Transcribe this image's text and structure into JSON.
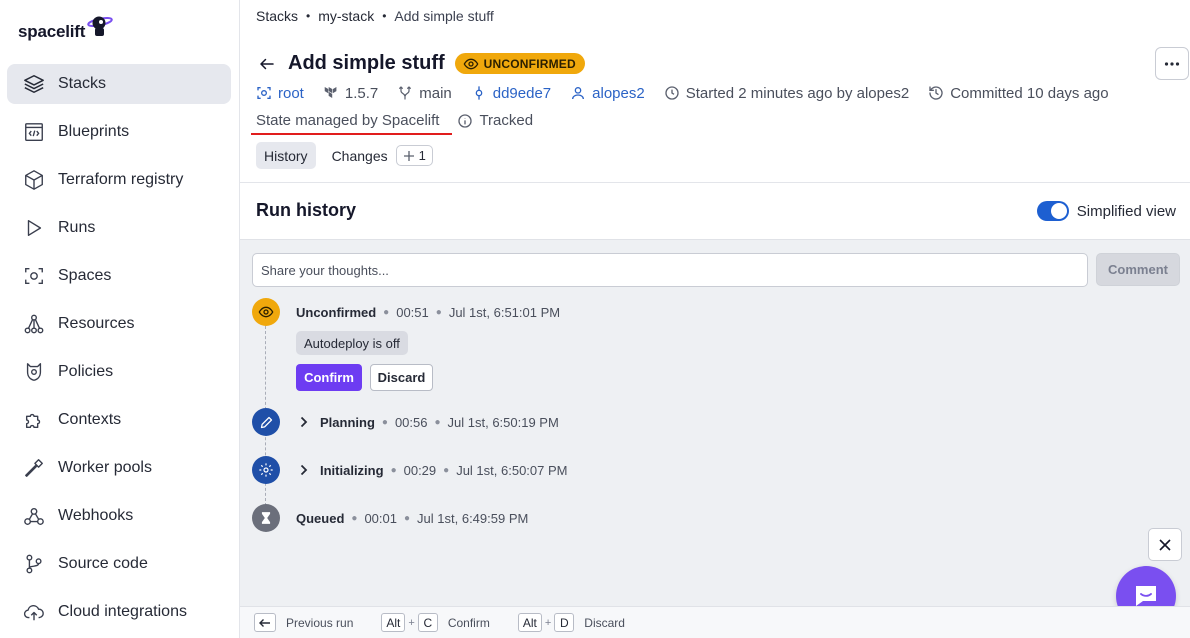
{
  "app": {
    "logo_text": "spacelift"
  },
  "sidebar": {
    "items": [
      {
        "label": "Stacks",
        "icon": "layers-icon",
        "active": true
      },
      {
        "label": "Blueprints",
        "icon": "blueprint-icon"
      },
      {
        "label": "Terraform registry",
        "icon": "cube-icon"
      },
      {
        "label": "Runs",
        "icon": "play-icon"
      },
      {
        "label": "Spaces",
        "icon": "spaces-icon"
      },
      {
        "label": "Resources",
        "icon": "resources-icon"
      },
      {
        "label": "Policies",
        "icon": "policy-icon"
      },
      {
        "label": "Contexts",
        "icon": "puzzle-icon"
      },
      {
        "label": "Worker pools",
        "icon": "hammer-icon"
      },
      {
        "label": "Webhooks",
        "icon": "webhook-icon"
      },
      {
        "label": "Source code",
        "icon": "git-icon"
      },
      {
        "label": "Cloud integrations",
        "icon": "cloud-icon"
      }
    ]
  },
  "breadcrumb": {
    "items": [
      "Stacks",
      "my-stack",
      "Add simple stuff"
    ],
    "separator": "•"
  },
  "header": {
    "title": "Add simple stuff",
    "badge": "UNCONFIRMED",
    "badge_color": "#f0a80c",
    "meta": {
      "space": "root",
      "version": "1.5.7",
      "branch": "main",
      "commit": "dd9ede7",
      "user": "alopes2",
      "started": "Started 2 minutes ago by alopes2",
      "committed": "Committed 10 days ago"
    },
    "state": "State managed by Spacelift",
    "tracked": "Tracked"
  },
  "tabs": {
    "history": "History",
    "changes": "Changes",
    "changes_count": "1"
  },
  "run_history": {
    "title": "Run history",
    "toggle_label": "Simplified view",
    "toggle_on": true,
    "comment_placeholder": "Share your thoughts...",
    "comment_button": "Comment",
    "timeline": [
      {
        "name": "Unconfirmed",
        "duration": "00:51",
        "time": "Jul 1st, 6:51:01 PM",
        "icon": "eye-icon",
        "color": "#f0a80c"
      },
      {
        "name": "Planning",
        "duration": "00:56",
        "time": "Jul 1st, 6:50:19 PM",
        "icon": "pencil-icon",
        "color": "#1f4fa8"
      },
      {
        "name": "Initializing",
        "duration": "00:29",
        "time": "Jul 1st, 6:50:07 PM",
        "icon": "gear-icon",
        "color": "#1f4fa8"
      },
      {
        "name": "Queued",
        "duration": "00:01",
        "time": "Jul 1st, 6:49:59 PM",
        "icon": "hourglass-icon",
        "color": "#6b6f7b"
      }
    ],
    "autodeploy": "Autodeploy is off",
    "confirm_button": "Confirm",
    "discard_button": "Discard"
  },
  "footer": {
    "previous_run": "Previous run",
    "alt_key": "Alt",
    "confirm_key": "C",
    "confirm_label": "Confirm",
    "discard_key": "D",
    "discard_label": "Discard"
  }
}
